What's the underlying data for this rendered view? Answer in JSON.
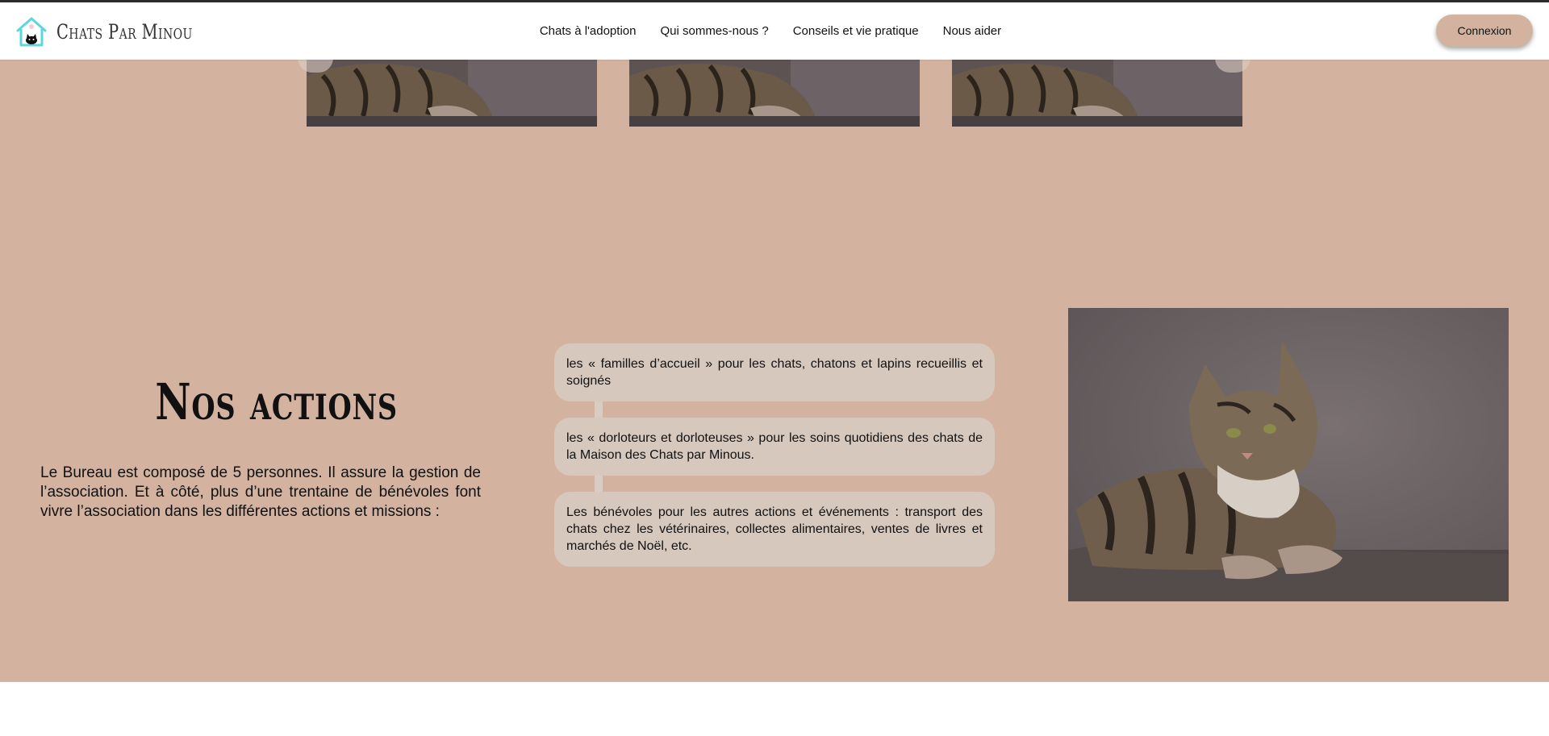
{
  "header": {
    "brand": "Chats Par Minou",
    "nav": [
      "Chats à l'adoption",
      "Qui sommes-nous ?",
      "Conseils et vie pratique",
      "Nous aider"
    ],
    "login_label": "Connexion",
    "logo_icon": "house-cat-logo-icon"
  },
  "carousel": {
    "items": [
      "cat-photo-1",
      "cat-photo-2",
      "cat-photo-3"
    ],
    "prev_icon": "chevron-left-icon",
    "next_icon": "chevron-right-icon"
  },
  "actions": {
    "title": "Nos actions",
    "intro": "Le Bureau est composé de 5 personnes. Il assure la gestion de l’association. Et à côté, plus d’une trentaine de bénévoles font vivre l’association dans les différentes actions et missions :",
    "items": [
      "les « familles d’accueil » pour les chats, chatons et lapins recueillis et soignés",
      "les « dorloteurs et dorloteuses » pour les soins quotidiens des chats de la Maison des Chats par Minous.",
      "Les bénévoles pour les autres actions et événements : transport des chats chez les vétérinaires, collectes alimentaires, ventes de livres et marchés de Noël, etc."
    ]
  },
  "colors": {
    "section_bg": "#d3b39f",
    "bubble_bg": "#d7c8be",
    "accent_logo": "#5fd6dc"
  }
}
